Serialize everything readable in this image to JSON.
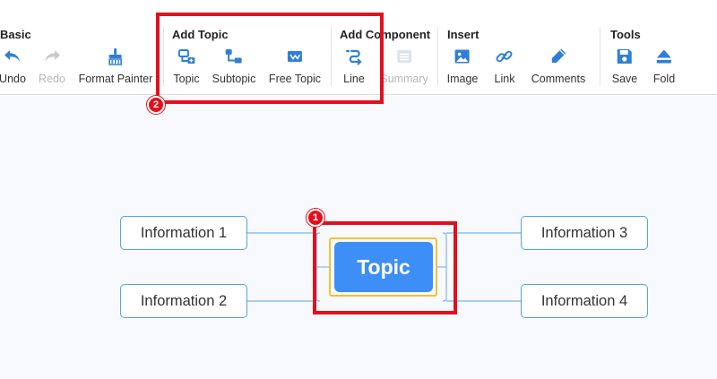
{
  "toolbar": {
    "groups": [
      {
        "title": "Basic",
        "tools": [
          {
            "label": "Undo",
            "icon": "undo-icon",
            "disabled": false
          },
          {
            "label": "Redo",
            "icon": "redo-icon",
            "disabled": true
          },
          {
            "label": "Format Painter",
            "icon": "format-painter-icon",
            "disabled": false
          }
        ]
      },
      {
        "title": "Add Topic",
        "tools": [
          {
            "label": "Topic",
            "icon": "topic-icon",
            "disabled": false
          },
          {
            "label": "Subtopic",
            "icon": "subtopic-icon",
            "disabled": false
          },
          {
            "label": "Free Topic",
            "icon": "free-topic-icon",
            "disabled": false
          }
        ]
      },
      {
        "title": "Add Component",
        "tools": [
          {
            "label": "Line",
            "icon": "line-icon",
            "disabled": false
          },
          {
            "label": "Summary",
            "icon": "summary-icon",
            "disabled": true
          }
        ]
      },
      {
        "title": "Insert",
        "tools": [
          {
            "label": "Image",
            "icon": "image-icon",
            "disabled": false
          },
          {
            "label": "Link",
            "icon": "link-icon",
            "disabled": false
          },
          {
            "label": "Comments",
            "icon": "comments-icon",
            "disabled": false
          }
        ]
      },
      {
        "title": "Tools",
        "tools": [
          {
            "label": "Save",
            "icon": "save-icon",
            "disabled": false
          },
          {
            "label": "Fold",
            "icon": "fold-icon",
            "disabled": false
          }
        ]
      }
    ]
  },
  "mindmap": {
    "central_topic": "Topic",
    "subtopics": [
      {
        "label": "Information 1"
      },
      {
        "label": "Information 2"
      },
      {
        "label": "Information 3"
      },
      {
        "label": "Information 4"
      }
    ]
  },
  "annotations": {
    "badge_1": "1",
    "badge_2": "2"
  },
  "colors": {
    "accent": "#3d8ef7",
    "icon": "#2f7fd8",
    "highlight": "#e3101c",
    "selection": "#f1c232",
    "node_border": "#5aa0e0"
  }
}
